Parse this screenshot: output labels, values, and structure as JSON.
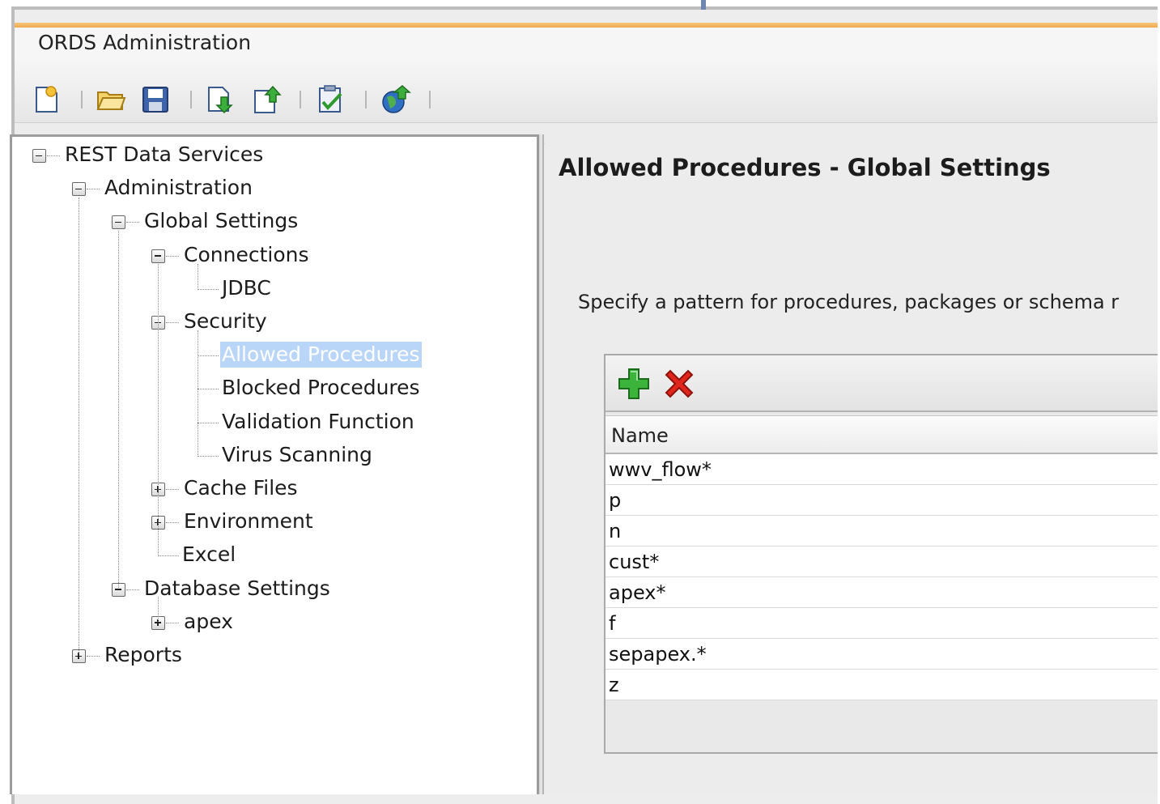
{
  "window": {
    "title": "ORDS Administration"
  },
  "toolbar": {
    "buttons": [
      {
        "name": "new-button",
        "icon": "new-document-icon"
      },
      {
        "name": "open-button",
        "icon": "open-folder-icon"
      },
      {
        "name": "save-button",
        "icon": "save-disk-icon"
      },
      {
        "name": "import-button",
        "icon": "import-document-icon"
      },
      {
        "name": "export-button",
        "icon": "export-document-icon"
      },
      {
        "name": "validate-button",
        "icon": "validate-checklist-icon"
      },
      {
        "name": "upload-button",
        "icon": "upload-globe-icon"
      }
    ]
  },
  "tree": {
    "nodes": [
      {
        "label": "REST Data Services",
        "expander": "minus"
      },
      {
        "label": "Administration",
        "expander": "minus"
      },
      {
        "label": "Global Settings",
        "expander": "minus"
      },
      {
        "label": "Connections",
        "expander": "minus"
      },
      {
        "label": "JDBC",
        "expander": "none"
      },
      {
        "label": "Security",
        "expander": "minus"
      },
      {
        "label": "Allowed Procedures",
        "expander": "none",
        "selected": true
      },
      {
        "label": "Blocked Procedures",
        "expander": "none"
      },
      {
        "label": "Validation Function",
        "expander": "none"
      },
      {
        "label": "Virus Scanning",
        "expander": "none"
      },
      {
        "label": "Cache Files",
        "expander": "plus"
      },
      {
        "label": "Environment",
        "expander": "plus"
      },
      {
        "label": "Excel",
        "expander": "none"
      },
      {
        "label": "Database Settings",
        "expander": "minus"
      },
      {
        "label": "apex",
        "expander": "plus"
      },
      {
        "label": "Reports",
        "expander": "plus"
      }
    ]
  },
  "content": {
    "title": "Allowed Procedures - Global Settings",
    "description": "Specify a pattern for procedures, packages or schema r",
    "list_toolbar": {
      "add_icon": "add-plus-icon",
      "remove_icon": "remove-x-icon"
    },
    "table": {
      "column_header": "Name",
      "rows": [
        "wwv_flow*",
        "p",
        "n",
        "cust*",
        "apex*",
        "f",
        "sepapex.*",
        "z"
      ]
    }
  },
  "colors": {
    "title_accent": "#f0a94c",
    "selection": "#b9d5f8",
    "add_green": "#2fa82f",
    "remove_red": "#d8201a"
  }
}
